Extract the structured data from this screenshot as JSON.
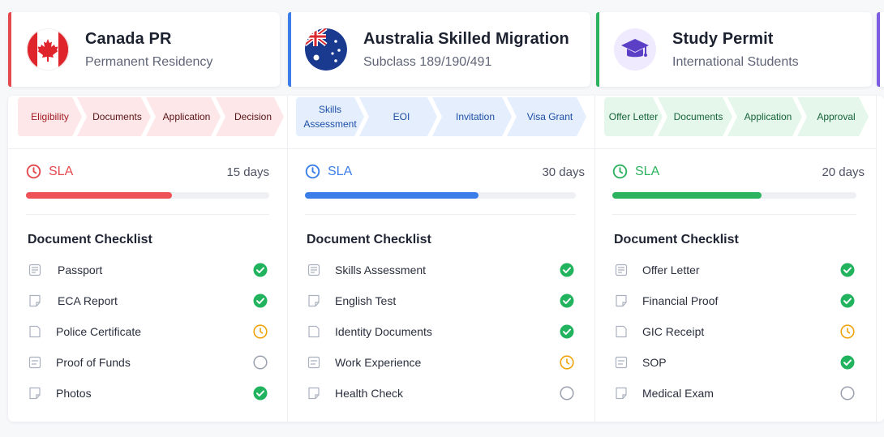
{
  "programs": [
    {
      "title": "Canada PR",
      "subtitle": "Permanent Residency",
      "flag_icon": "canada-flag-icon",
      "accent": "#e5484d",
      "step_bg": "#fde7e8",
      "step_text": "#a21d24",
      "steps": [
        "Eligibility",
        "Documents",
        "Application",
        "Decision"
      ],
      "sla_label": "SLA",
      "sla_days": "15 days",
      "sla_progress": 0.6,
      "checklist_title": "Document Checklist",
      "documents": [
        {
          "name": "Passport",
          "status": "complete"
        },
        {
          "name": "ECA Report",
          "status": "complete"
        },
        {
          "name": "Police Certificate",
          "status": "pending"
        },
        {
          "name": "Proof of Funds",
          "status": "not-started"
        },
        {
          "name": "Photos",
          "status": "complete"
        }
      ]
    },
    {
      "title": "Australia Skilled Migration",
      "subtitle": "Subclass 189/190/491",
      "flag_icon": "australia-flag-icon",
      "accent": "#3b7ee9",
      "step_bg": "#e4eefd",
      "step_text": "#1d4fa5",
      "steps": [
        "Skills Assessment",
        "EOI",
        "Invitation",
        "Visa Grant"
      ],
      "sla_label": "SLA",
      "sla_days": "30 days",
      "sla_progress": 0.64,
      "checklist_title": "Document Checklist",
      "documents": [
        {
          "name": "Skills Assessment",
          "status": "complete"
        },
        {
          "name": "English Test",
          "status": "complete"
        },
        {
          "name": "Identity Documents",
          "status": "complete"
        },
        {
          "name": "Work Experience",
          "status": "pending"
        },
        {
          "name": "Health Check",
          "status": "not-started"
        }
      ]
    },
    {
      "title": "Study Permit",
      "subtitle": "International Students",
      "flag_icon": "graduation-cap-icon",
      "accent": "#2db35f",
      "step_bg": "#e5f6eb",
      "step_text": "#16653a",
      "steps": [
        "Offer Letter",
        "Documents",
        "Application",
        "Approval"
      ],
      "sla_label": "SLA",
      "sla_days": "20 days",
      "sla_progress": 0.61,
      "checklist_title": "Document Checklist",
      "documents": [
        {
          "name": "Offer Letter",
          "status": "complete"
        },
        {
          "name": "Financial Proof",
          "status": "complete"
        },
        {
          "name": "GIC Receipt",
          "status": "pending"
        },
        {
          "name": "SOP",
          "status": "complete"
        },
        {
          "name": "Medical Exam",
          "status": "not-started"
        }
      ]
    }
  ],
  "status_colors": {
    "complete": "#22b35e",
    "pending": "#f0a30a",
    "not-started": "#9aa0ae"
  },
  "fourth_accent": "#7c5ce0"
}
